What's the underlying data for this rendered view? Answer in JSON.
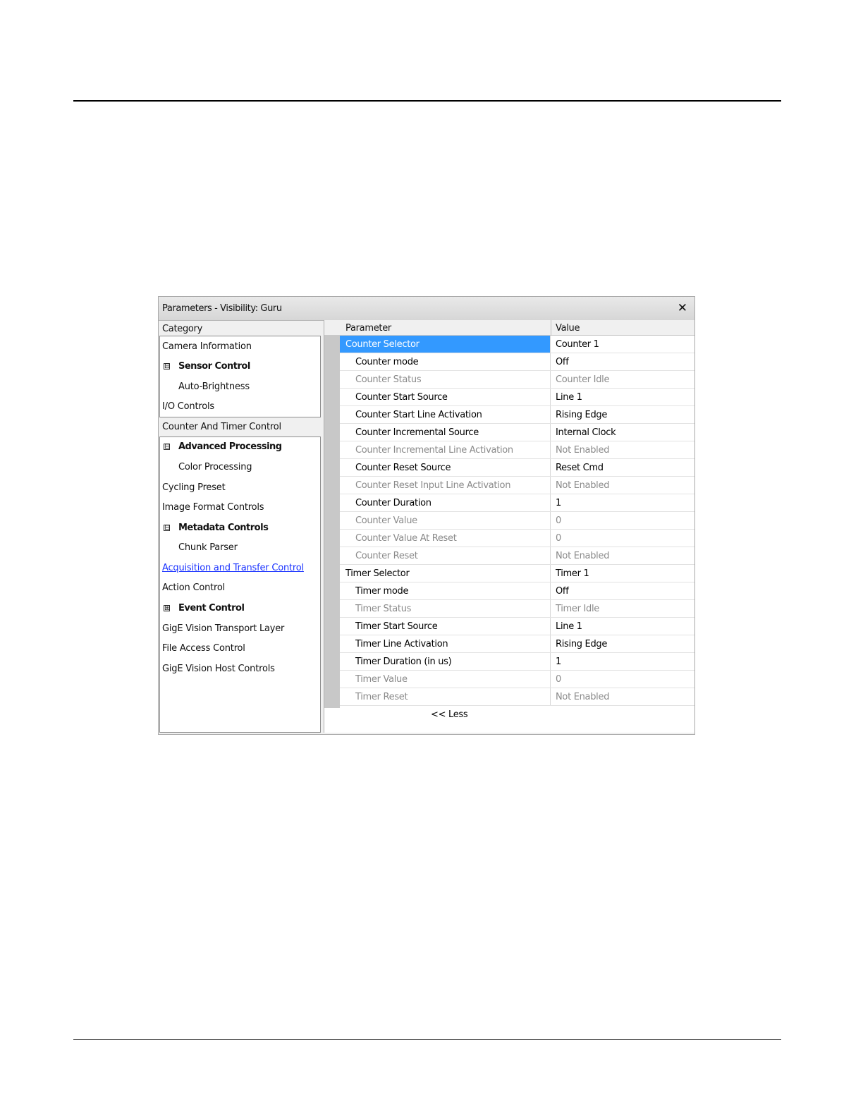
{
  "window": {
    "title": "Parameters - Visibility: Guru",
    "close_glyph": "✕"
  },
  "category": {
    "header": "Category",
    "items": [
      {
        "label": "Camera Information"
      },
      {
        "label": "Sensor Control",
        "toggle": "⊟"
      },
      {
        "label": "Auto-Brightness"
      },
      {
        "label": "I/O Controls"
      },
      {
        "label": "Counter And Timer Control"
      },
      {
        "label": "Advanced Processing",
        "toggle": "⊟"
      },
      {
        "label": "Color Processing"
      },
      {
        "label": "Cycling Preset"
      },
      {
        "label": "Image Format Controls"
      },
      {
        "label": "Metadata Controls",
        "toggle": "⊟"
      },
      {
        "label": "Chunk Parser"
      },
      {
        "label": "Acquisition and Transfer Control"
      },
      {
        "label": "Action Control"
      },
      {
        "label": "Event Control",
        "toggle": "⊞"
      },
      {
        "label": "GigE Vision Transport Layer"
      },
      {
        "label": "File Access Control"
      },
      {
        "label": "GigE Vision Host Controls"
      }
    ]
  },
  "grid": {
    "header_parameter": "Parameter",
    "header_value": "Value",
    "rows": [
      {
        "param": "Counter Selector",
        "value": "Counter 1"
      },
      {
        "param": "Counter mode",
        "value": "Off"
      },
      {
        "param": "Counter Status",
        "value": "Counter Idle"
      },
      {
        "param": "Counter Start Source",
        "value": "Line 1"
      },
      {
        "param": "Counter Start Line Activation",
        "value": "Rising Edge"
      },
      {
        "param": "Counter Incremental Source",
        "value": "Internal Clock"
      },
      {
        "param": "Counter Incremental Line Activation",
        "value": "Not Enabled"
      },
      {
        "param": "Counter Reset Source",
        "value": "Reset Cmd"
      },
      {
        "param": "Counter Reset Input Line Activation",
        "value": "Not Enabled"
      },
      {
        "param": "Counter Duration",
        "value": "1"
      },
      {
        "param": "Counter Value",
        "value": "0"
      },
      {
        "param": "Counter Value At Reset",
        "value": "0"
      },
      {
        "param": "Counter Reset",
        "value": "Not Enabled"
      },
      {
        "param": "Timer Selector",
        "value": "Timer 1"
      },
      {
        "param": "Timer mode",
        "value": "Off"
      },
      {
        "param": "Timer Status",
        "value": "Timer Idle"
      },
      {
        "param": "Timer Start Source",
        "value": "Line 1"
      },
      {
        "param": "Timer Line Activation",
        "value": "Rising Edge"
      },
      {
        "param": "Timer Duration (in us)",
        "value": "1"
      },
      {
        "param": "Timer Value",
        "value": "0"
      },
      {
        "param": "Timer Reset",
        "value": "Not Enabled"
      }
    ],
    "less_label": "<< Less"
  },
  "colors": {
    "selection": "#3399ff",
    "link": "#1a33ff",
    "disabled_text": "#8a8a8a"
  }
}
